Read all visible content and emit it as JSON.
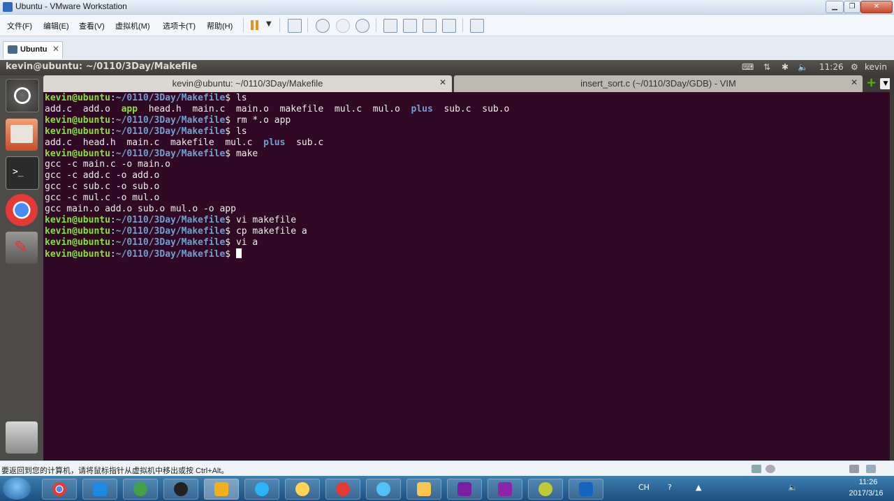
{
  "window": {
    "title": "Ubuntu - VMware Workstation"
  },
  "menu": [
    "文件(F)",
    "编辑(E)",
    "查看(V)",
    "虚拟机(M)",
    "选项卡(T)",
    "帮助(H)"
  ],
  "vm_tab": {
    "label": "Ubuntu"
  },
  "ubuntu_panel": {
    "title": "kevin@ubuntu: ~/0110/3Day/Makefile",
    "time": "11:26",
    "user": "kevin"
  },
  "terminal_tabs": [
    {
      "label": "kevin@ubuntu: ~/0110/3Day/Makefile",
      "active": true
    },
    {
      "label": "insert_sort.c (~/0110/3Day/GDB) - VIM",
      "active": false
    }
  ],
  "prompt": {
    "user": "kevin@ubuntu",
    "path": "~/0110/3Day/Makefile"
  },
  "lines": [
    {
      "kind": "cmd",
      "text": "ls"
    },
    {
      "kind": "ls",
      "items": [
        {
          "t": "add.c",
          "c": "f"
        },
        {
          "t": "add.o",
          "c": "f"
        },
        {
          "t": "app",
          "c": "exe"
        },
        {
          "t": "head.h",
          "c": "f"
        },
        {
          "t": "main.c",
          "c": "f"
        },
        {
          "t": "main.o",
          "c": "f"
        },
        {
          "t": "makefile",
          "c": "f"
        },
        {
          "t": "mul.c",
          "c": "f"
        },
        {
          "t": "mul.o",
          "c": "f"
        },
        {
          "t": "plus",
          "c": "dir"
        },
        {
          "t": "sub.c",
          "c": "f"
        },
        {
          "t": "sub.o",
          "c": "f"
        }
      ]
    },
    {
      "kind": "cmd",
      "text": "rm *.o app"
    },
    {
      "kind": "cmd",
      "text": "ls"
    },
    {
      "kind": "ls",
      "items": [
        {
          "t": "add.c",
          "c": "f"
        },
        {
          "t": "head.h",
          "c": "f"
        },
        {
          "t": "main.c",
          "c": "f"
        },
        {
          "t": "makefile",
          "c": "f"
        },
        {
          "t": "mul.c",
          "c": "f"
        },
        {
          "t": "plus",
          "c": "dir"
        },
        {
          "t": "sub.c",
          "c": "f"
        }
      ]
    },
    {
      "kind": "cmd",
      "text": "make"
    },
    {
      "kind": "out",
      "text": "gcc -c main.c -o main.o"
    },
    {
      "kind": "out",
      "text": "gcc -c add.c -o add.o"
    },
    {
      "kind": "out",
      "text": "gcc -c sub.c -o sub.o"
    },
    {
      "kind": "out",
      "text": "gcc -c mul.c -o mul.o"
    },
    {
      "kind": "out",
      "text": "gcc main.o add.o sub.o mul.o -o app"
    },
    {
      "kind": "cmd",
      "text": "vi makefile"
    },
    {
      "kind": "cmd",
      "text": "cp makefile a"
    },
    {
      "kind": "cmd",
      "text": "vi a"
    },
    {
      "kind": "cmd",
      "text": "",
      "cursor": true
    }
  ],
  "statusbar": {
    "message": "要返回到您的计算机，请将鼠标指针从虚拟机中移出或按 Ctrl+Alt。"
  },
  "taskbar": {
    "clock_time": "11:26",
    "clock_date": "2017/3/16",
    "tray_text": "CH"
  },
  "colors": {
    "terminal_bg": "#300a24",
    "prompt_user": "#8ae234",
    "prompt_path": "#729fcf"
  }
}
